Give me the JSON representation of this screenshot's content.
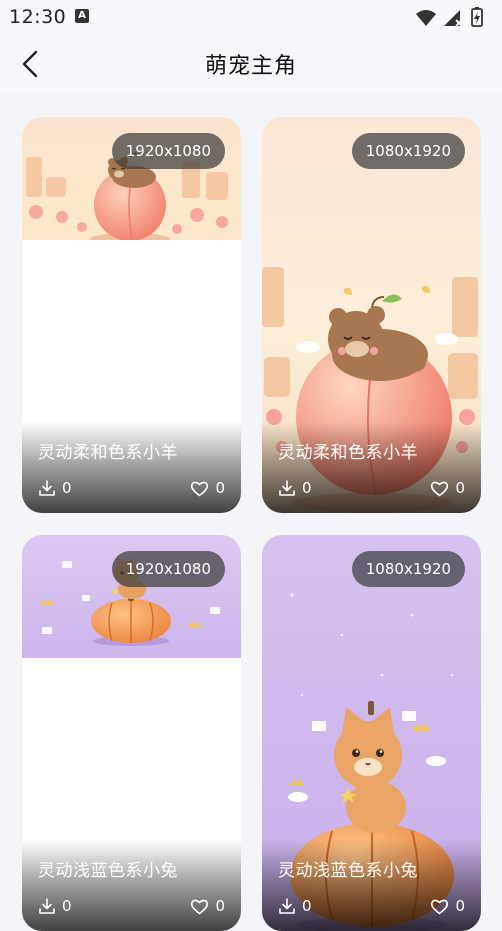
{
  "status": {
    "time": "12:30",
    "notif_letter": "A"
  },
  "header": {
    "title": "萌宠主角"
  },
  "cards": [
    {
      "resolution": "1920x1080",
      "title": "灵动柔和色系小羊",
      "downloads": "0",
      "likes": "0",
      "illustration": "bear-on-peach"
    },
    {
      "resolution": "1080x1920",
      "title": "灵动柔和色系小羊",
      "downloads": "0",
      "likes": "0",
      "illustration": "bear-on-peach"
    },
    {
      "resolution": "1920x1080",
      "title": "灵动浅蓝色系小兔",
      "downloads": "0",
      "likes": "0",
      "illustration": "cat-on-pumpkin"
    },
    {
      "resolution": "1080x1920",
      "title": "灵动浅蓝色系小兔",
      "downloads": "0",
      "likes": "0",
      "illustration": "cat-on-pumpkin"
    }
  ],
  "icons": {
    "back": "chevron-left-icon",
    "download": "download-icon",
    "like": "heart-icon"
  },
  "colors": {
    "background": "#f4f5f9",
    "badge": "#3c3c3c",
    "peach": "#f4917e",
    "pumpkin": "#f09a45",
    "lavender": "#d9c6f0"
  }
}
